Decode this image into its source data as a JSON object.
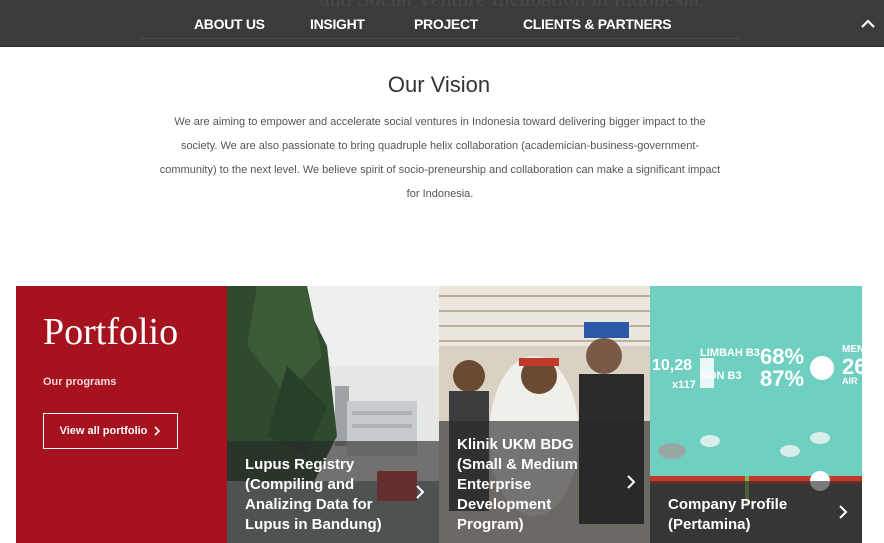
{
  "nav": {
    "ghost_text": "and Social Venture Incubation in Indonesia.",
    "items": [
      {
        "label": "ABOUT US"
      },
      {
        "label": "INSIGHT"
      },
      {
        "label": "PROJECT"
      },
      {
        "label": "CLIENTS & PARTNERS"
      }
    ],
    "toggle_icon": "chevron-up-icon"
  },
  "vision": {
    "title": "Our Vision",
    "lines": [
      "We are aiming to empower and accelerate social ventures in Indonesia toward delivering bigger impact to the",
      "society. We are also passionate to bring quadruple helix collaboration (academician-business-government-",
      "community) to the next level. We believe spirit of socio-preneurship and collaboration can make a significant impact",
      "for Indonesia."
    ]
  },
  "portfolio": {
    "heading": "Portfolio",
    "subheading": "Our programs",
    "button_label": "View all portfolio",
    "accent_color": "#a6121d",
    "cards": [
      {
        "caption": "Lupus Registry (Compiling and Analizing Data for Lupus in Bandung)"
      },
      {
        "caption": "Klinik UKM BDG (Small & Medium Enterprise Development Program)"
      },
      {
        "caption": "Company Profile (Pertamina)"
      }
    ],
    "infographic": {
      "labels": [
        "LIMBAH B3",
        "NON B3",
        "68%",
        "87%",
        "10,28",
        "x117",
        "MEN",
        "26",
        "AIR"
      ]
    }
  }
}
